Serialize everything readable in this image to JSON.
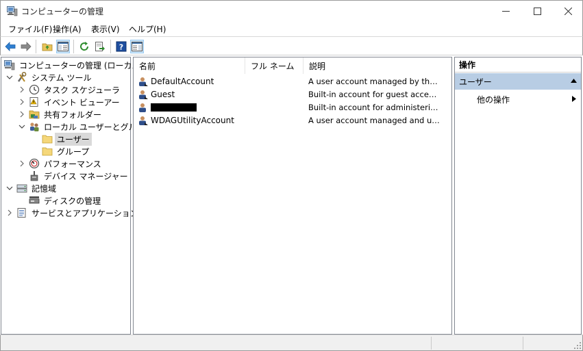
{
  "window": {
    "title": "コンピューターの管理"
  },
  "menu": [
    "ファイル(F)",
    "操作(A)",
    "表示(V)",
    "ヘルプ(H)"
  ],
  "toolbar": {
    "icons": [
      "back-arrow-icon",
      "forward-arrow-icon",
      "up-folder-icon",
      "show-hide-console-tree-icon",
      "refresh-icon",
      "export-list-icon",
      "help-icon",
      "show-hide-action-pane-icon"
    ]
  },
  "tree": {
    "root": "コンピューターの管理 (ローカル)",
    "system_tools": "システム ツール",
    "task_scheduler": "タスク スケジューラ",
    "event_viewer": "イベント ビューアー",
    "shared_folders": "共有フォルダー",
    "local_users_groups": "ローカル ユーザーとグループ",
    "users": "ユーザー",
    "groups": "グループ",
    "performance": "パフォーマンス",
    "device_manager": "デバイス マネージャー",
    "storage": "記憶域",
    "disk_management": "ディスクの管理",
    "services_apps": "サービスとアプリケーション"
  },
  "list": {
    "columns": [
      "名前",
      "フル ネーム",
      "説明"
    ],
    "rows": [
      {
        "name": "DefaultAccount",
        "full_name": "",
        "description": "A user account managed by the s..."
      },
      {
        "name": "Guest",
        "full_name": "",
        "description": "Built-in account for guest access t..."
      },
      {
        "name": "",
        "full_name": "",
        "description": "Built-in account for administering...",
        "redacted": true
      },
      {
        "name": "WDAGUtilityAccount",
        "full_name": "",
        "description": "A user account managed and use..."
      }
    ]
  },
  "actions": {
    "header": "操作",
    "section": "ユーザー",
    "more": "他の操作",
    "section_color": "#b8cde4"
  }
}
